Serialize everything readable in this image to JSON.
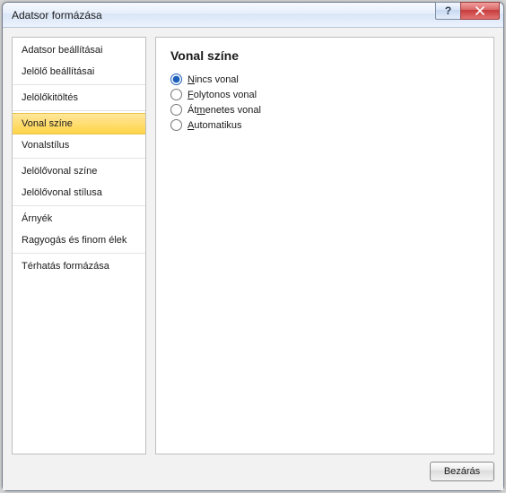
{
  "window": {
    "title": "Adatsor formázása"
  },
  "sidebar": {
    "items": [
      {
        "label": "Adatsor beállításai",
        "selected": false,
        "sep_after": false
      },
      {
        "label": "Jelölő beállításai",
        "selected": false,
        "sep_after": true
      },
      {
        "label": "Jelölőkitöltés",
        "selected": false,
        "sep_after": true
      },
      {
        "label": "Vonal színe",
        "selected": true,
        "sep_after": false
      },
      {
        "label": "Vonalstílus",
        "selected": false,
        "sep_after": true
      },
      {
        "label": "Jelölővonal színe",
        "selected": false,
        "sep_after": false
      },
      {
        "label": "Jelölővonal stílusa",
        "selected": false,
        "sep_after": true
      },
      {
        "label": "Árnyék",
        "selected": false,
        "sep_after": false
      },
      {
        "label": "Ragyogás és finom élek",
        "selected": false,
        "sep_after": true
      },
      {
        "label": "Térhatás formázása",
        "selected": false,
        "sep_after": false
      }
    ]
  },
  "content": {
    "heading": "Vonal színe",
    "options": [
      {
        "label": "Nincs vonal",
        "underline_index": 0,
        "checked": true
      },
      {
        "label": "Folytonos vonal",
        "underline_index": 0,
        "checked": false
      },
      {
        "label": "Átmenetes vonal",
        "underline_index": 2,
        "checked": false
      },
      {
        "label": "Automatikus",
        "underline_index": 0,
        "checked": false
      }
    ]
  },
  "footer": {
    "close_label": "Bezárás"
  }
}
